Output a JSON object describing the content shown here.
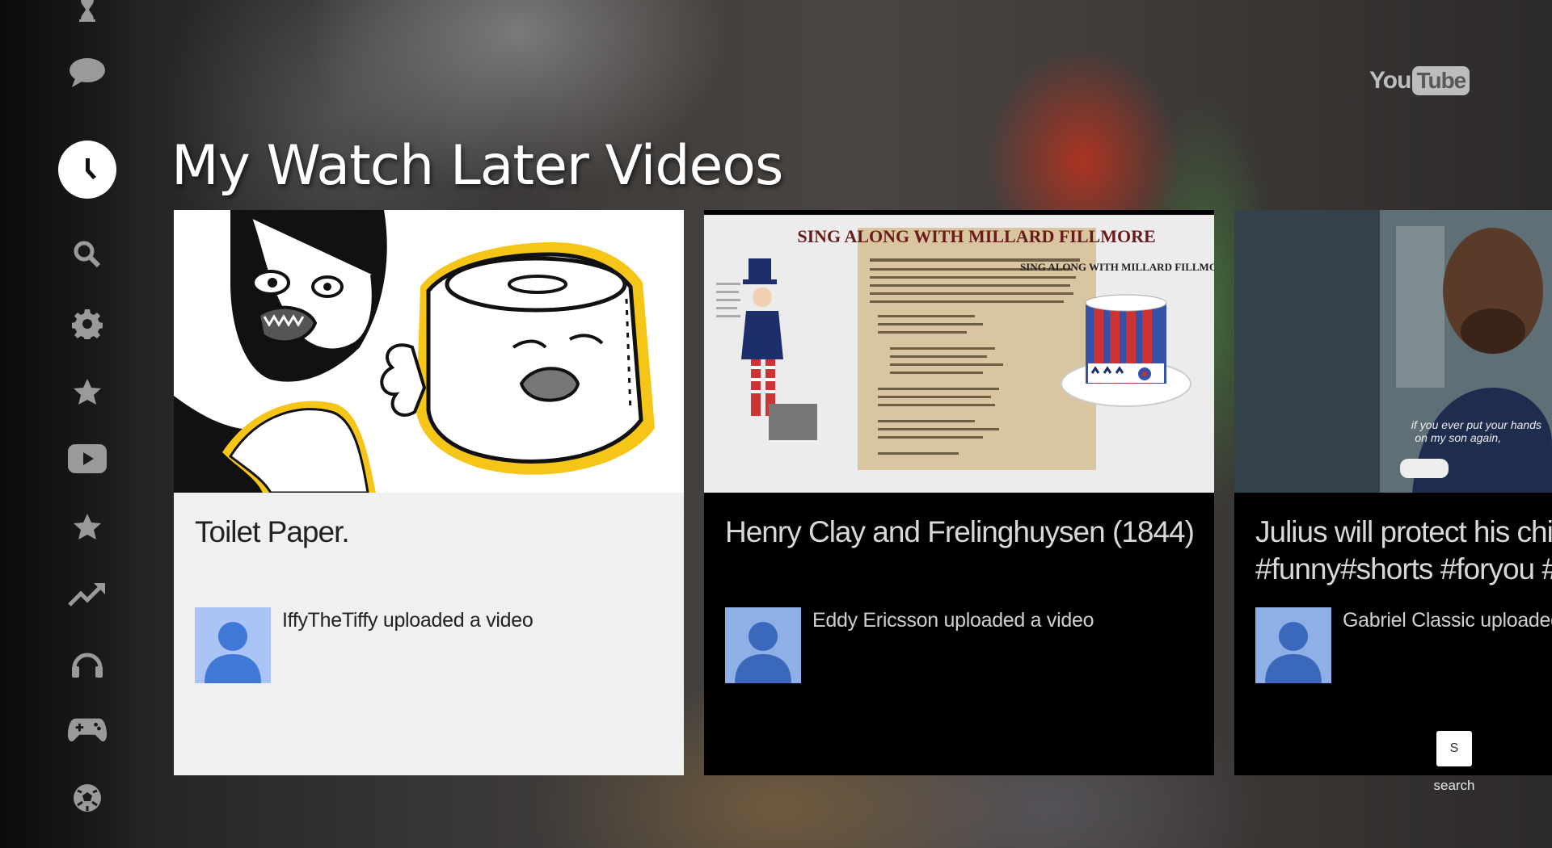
{
  "app": {
    "page_title": "My Watch Later Videos",
    "logo": {
      "you": "You",
      "tube": "Tube"
    }
  },
  "sidebar": {
    "items": [
      {
        "icon": "hourglass-icon",
        "active": false
      },
      {
        "icon": "chat-bubble-icon",
        "active": false
      },
      {
        "icon": "clock-icon",
        "active": true
      },
      {
        "icon": "search-icon",
        "active": false
      },
      {
        "icon": "gear-icon",
        "active": false
      },
      {
        "icon": "star-icon",
        "active": false
      },
      {
        "icon": "youtube-play-icon",
        "active": false
      },
      {
        "icon": "star-icon",
        "active": false
      },
      {
        "icon": "trending-icon",
        "active": false
      },
      {
        "icon": "headphones-icon",
        "active": false
      },
      {
        "icon": "gamepad-icon",
        "active": false
      },
      {
        "icon": "soccer-ball-icon",
        "active": false
      }
    ]
  },
  "videos": [
    {
      "title": "Toilet Paper.",
      "uploader": "IffyTheTiffy uploaded a video",
      "focused": true
    },
    {
      "title": "Henry Clay and Frelinghuysen (1844)",
      "uploader": "Eddy Ericsson uploaded a video",
      "focused": false,
      "thumb_text": {
        "banner": "SING ALONG WITH MILLARD FILLMORE",
        "side": "SING ALONG WITH MILLARD FILLMORE"
      }
    },
    {
      "title_line1": "Julius will protect his chi",
      "title_line2": "#funny#shorts #foryou #",
      "uploader": "Gabriel Classic uploaded",
      "focused": false,
      "thumb_text": {
        "subtitle1": "if you ever put your hands",
        "subtitle2": "on my son again,"
      }
    }
  ],
  "search_hint": {
    "key": "S",
    "label": "search"
  },
  "colors": {
    "accent": "#ffffff",
    "card_focused_bg": "#f0f0f0",
    "card_bg": "#000000",
    "avatar": "#8fb0e6"
  }
}
